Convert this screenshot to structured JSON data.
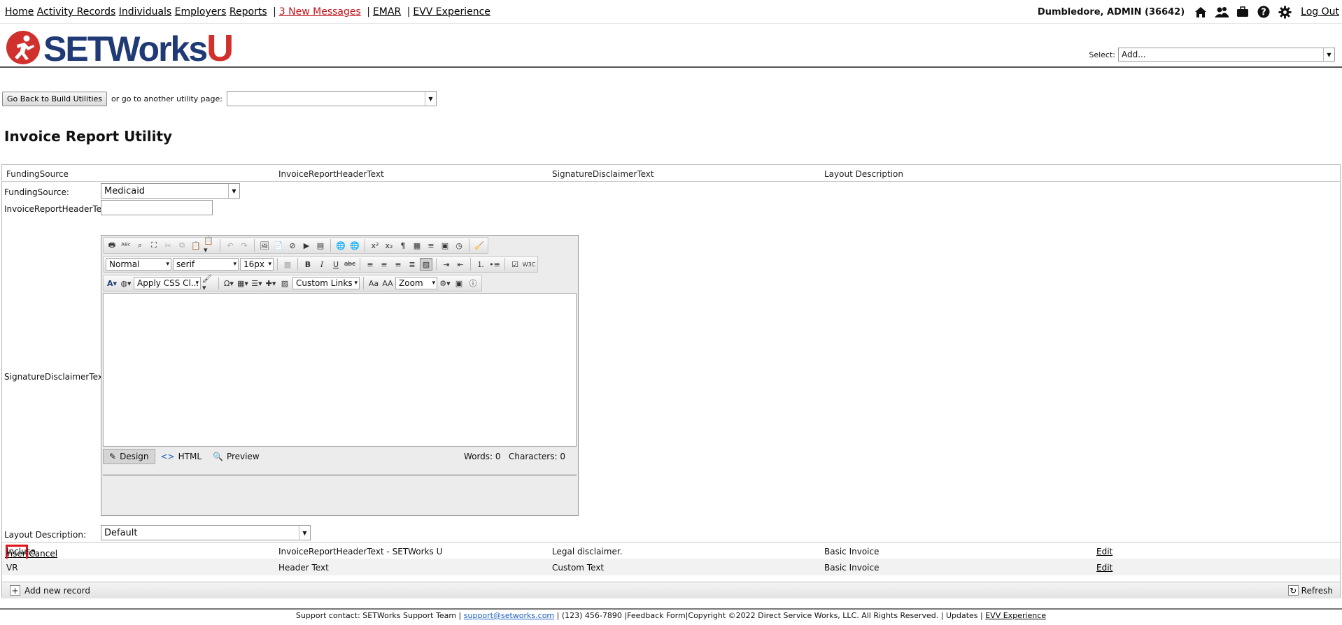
{
  "nav": {
    "items": [
      "Home",
      "Activity Records",
      "Individuals",
      "Employers",
      "Reports"
    ],
    "messages": "3 New Messages",
    "emar": "EMAR",
    "evv": "EVV Experience",
    "user": "Dumbledore, ADMIN  (36642)",
    "logout": "Log Out"
  },
  "header": {
    "logo_text": "SETWorks",
    "logo_u": "U",
    "select_label": "Select:",
    "select_value": "Add..."
  },
  "util": {
    "back_button": "Go Back to Build Utilities",
    "other_label": "or go to another utility page:",
    "other_value": ""
  },
  "page": {
    "title": "Invoice Report Utility"
  },
  "grid": {
    "columns": [
      "FundingSource",
      "InvoiceReportHeaderText",
      "SignatureDisclaimerText",
      "Layout Description"
    ],
    "form": {
      "funding_label": "FundingSource:",
      "funding_value": "Medicaid",
      "header_label": "InvoiceReportHeaderText:",
      "header_value": "",
      "signature_label": "SignatureDisclaimerText:",
      "layout_label": "Layout Description:",
      "layout_value": "Default",
      "insert": "Insert",
      "cancel": "Cancel"
    },
    "editor": {
      "format": "Normal",
      "font": "serif",
      "size": "16px",
      "css_class": "Apply CSS Cl...",
      "custom_links": "Custom Links",
      "zoom": "Zoom",
      "mode_design": "Design",
      "mode_html": "HTML",
      "mode_preview": "Preview",
      "words": "Words: 0",
      "characters": "Characters: 0"
    },
    "rows": [
      {
        "funding": "Inclusa",
        "header": "InvoiceReportHeaderText - SETWorks U",
        "signature": "Legal disclaimer.",
        "layout": "Basic Invoice",
        "action": "Edit"
      },
      {
        "funding": "VR",
        "header": "Header Text",
        "signature": "Custom Text",
        "layout": "Basic Invoice",
        "action": "Edit"
      }
    ],
    "add_new": "Add new record",
    "refresh": "Refresh"
  },
  "footer": {
    "support": "Support contact: SETWorks Support Team",
    "email": "support@setworks.com",
    "rest": "(123) 456-7890 |Feedback Form|Copyright ©2022 Direct Service Works, LLC. All Rights Reserved.",
    "updates": "Updates",
    "evv": "EVV Experience"
  },
  "colors": {
    "brand_blue": "#1f3a74",
    "brand_red": "#d0312d",
    "highlight": "#e0141c"
  }
}
